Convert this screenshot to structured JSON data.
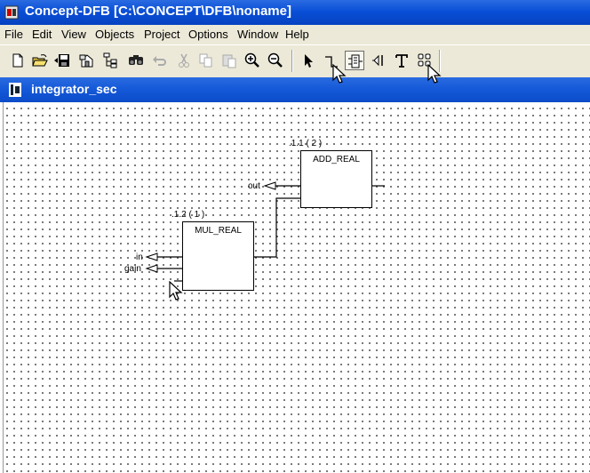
{
  "window": {
    "title": "Concept-DFB [C:\\CONCEPT\\DFB\\noname]"
  },
  "menu": [
    "File",
    "Edit",
    "View",
    "Objects",
    "Project",
    "Options",
    "Window",
    "Help"
  ],
  "toolbar": {
    "buttons": [
      "new-file-icon",
      "open-folder-icon",
      "save-icon",
      "properties-icon",
      "tree-icon",
      "find-icon",
      "undo-icon",
      "cut-icon",
      "copy-icon",
      "paste-icon",
      "zoom-in-icon",
      "zoom-out-icon",
      "select-arrow-icon",
      "link-icon",
      "fb-block-icon",
      "input-pin-icon",
      "text-icon",
      "grid-icon"
    ],
    "pressed": "fb-block-icon"
  },
  "document": {
    "title": "integrator_sec"
  },
  "blocks": [
    {
      "id": ".1.1 ( 2 )",
      "type": "ADD_REAL"
    },
    {
      "id": ".1.2 ( 1 )",
      "type": "MUL_REAL"
    }
  ],
  "pins": {
    "out": "out",
    "in": "in",
    "gain": "gain"
  }
}
